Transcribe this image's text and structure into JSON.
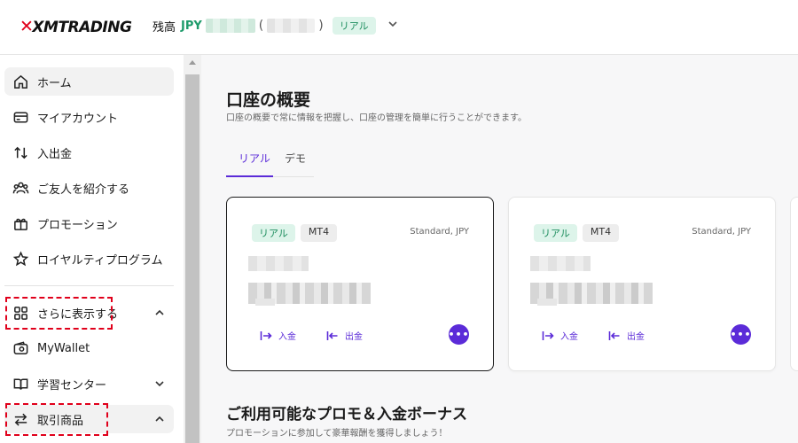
{
  "header": {
    "logo_text": "XMTRADING",
    "balance_label": "残高",
    "currency": "JPY",
    "paren_open": "(",
    "paren_close": ")",
    "account_badge": "リアル"
  },
  "sidebar": {
    "items": [
      {
        "label": "ホーム",
        "icon": "home-icon"
      },
      {
        "label": "マイアカウント",
        "icon": "card-icon"
      },
      {
        "label": "入出金",
        "icon": "transfer-icon"
      },
      {
        "label": "ご友人を紹介する",
        "icon": "users-icon"
      },
      {
        "label": "プロモーション",
        "icon": "gift-icon"
      },
      {
        "label": "ロイヤルティプログラム",
        "icon": "star-icon"
      },
      {
        "label": "さらに表示する",
        "icon": "grid-icon"
      },
      {
        "label": "MyWallet",
        "icon": "wallet-icon"
      },
      {
        "label": "学習センター",
        "icon": "book-icon"
      },
      {
        "label": "取引商品",
        "icon": "swap-icon"
      }
    ],
    "highlight_color": "#e0001b"
  },
  "main": {
    "title": "口座の概要",
    "subtitle": "口座の概要で常に情報を把握し、口座の管理を簡単に行うことができます。",
    "tabs": [
      {
        "label": "リアル",
        "active": true
      },
      {
        "label": "デモ",
        "active": false
      }
    ],
    "cards": [
      {
        "badge": "リアル",
        "platform": "MT4",
        "type": "Standard, JPY",
        "deposit": "入金",
        "withdraw": "出金",
        "selected": true
      },
      {
        "badge": "リアル",
        "platform": "MT4",
        "type": "Standard, JPY",
        "deposit": "入金",
        "withdraw": "出金",
        "selected": false
      }
    ],
    "more_symbol": "•••",
    "promo_title": "ご利用可能なプロモ＆入金ボーナス",
    "promo_subtitle": "プロモーションに参加して豪華報酬を獲得しましょう！",
    "accent_color": "#5b2bd8"
  }
}
